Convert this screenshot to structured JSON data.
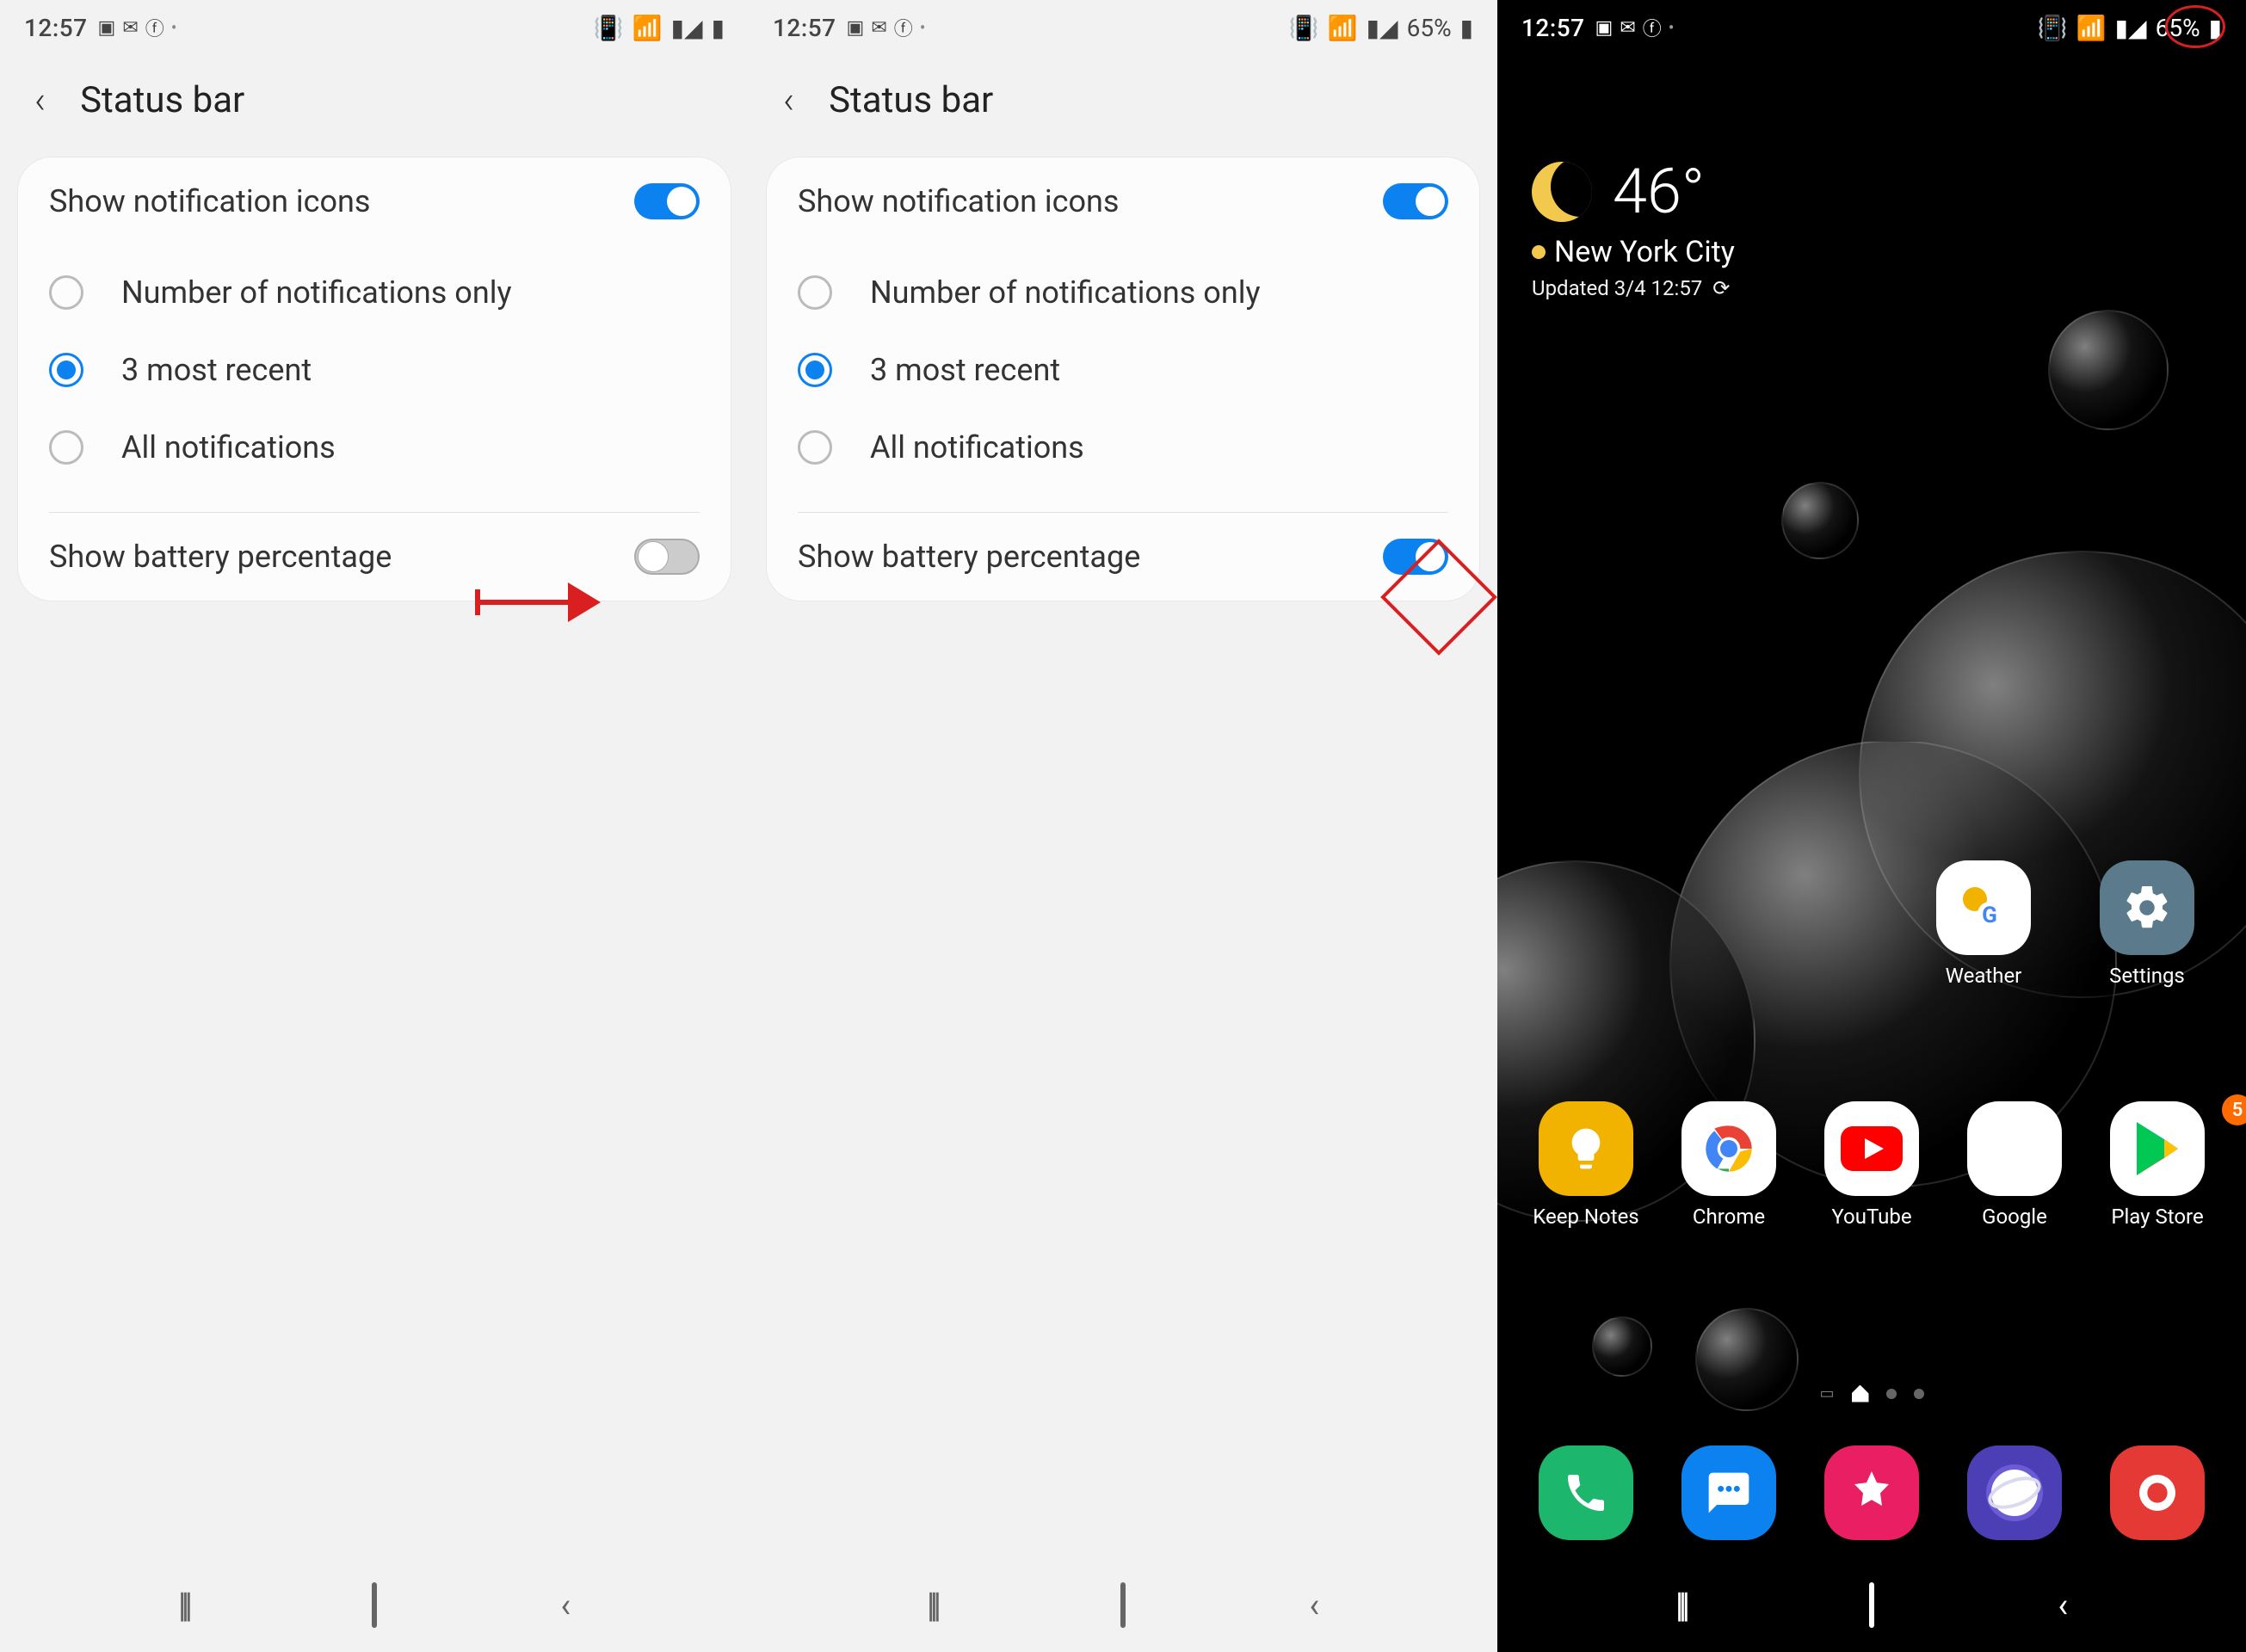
{
  "status": {
    "time": "12:57",
    "battery_pct": "65%"
  },
  "settings": {
    "title": "Status bar",
    "show_notif_label": "Show notification icons",
    "radio_options": {
      "opt1": "Number of notifications only",
      "opt2": "3 most recent",
      "opt3": "All notifications"
    },
    "battery_pct_label": "Show battery percentage"
  },
  "home": {
    "weather": {
      "temp": "46°",
      "location": "New York City",
      "updated": "Updated 3/4 12:57"
    },
    "apps_top": {
      "weather": "Weather",
      "settings": "Settings"
    },
    "apps_row": {
      "keep": "Keep Notes",
      "chrome": "Chrome",
      "youtube": "YouTube",
      "google": "Google",
      "play": "Play Store",
      "google_badge": "5"
    }
  }
}
